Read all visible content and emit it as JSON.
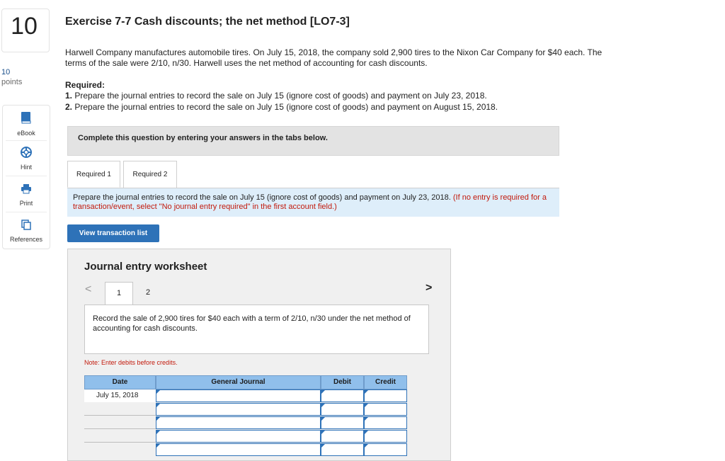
{
  "question": {
    "number": "10",
    "points_value": "10",
    "points_label": "points"
  },
  "tools": [
    {
      "label": "eBook",
      "icon": "book-icon"
    },
    {
      "label": "Hint",
      "icon": "lifebuoy-icon"
    },
    {
      "label": "Print",
      "icon": "printer-icon"
    },
    {
      "label": "References",
      "icon": "copy-icon"
    }
  ],
  "header": {
    "title": "Exercise 7-7 Cash discounts; the net method [LO7-3]",
    "intro": "Harwell Company manufactures automobile tires. On July 15, 2018, the company sold 2,900 tires to the Nixon Car Company for $40 each. The terms of the sale were 2/10, n/30. Harwell uses the net method of accounting for cash discounts.",
    "required_label": "Required:",
    "required_items": [
      {
        "num": "1.",
        "text": "Prepare the journal entries to record the sale on July 15 (ignore cost of goods) and payment on July 23, 2018."
      },
      {
        "num": "2.",
        "text": "Prepare the journal entries to record the sale on July 15 (ignore cost of goods) and payment on August 15, 2018."
      }
    ]
  },
  "complete_bar": "Complete this question by entering your answers in the tabs below.",
  "tabs": [
    {
      "label": "Required 1"
    },
    {
      "label": "Required 2"
    }
  ],
  "instruction": {
    "text": "Prepare the journal entries to record the sale on July 15 (ignore cost of goods) and payment on July 23, 2018.",
    "red_text": "(If no entry is required for a transaction/event, select \"No journal entry required\" in the first account field.)"
  },
  "view_button": "View transaction list",
  "worksheet": {
    "title": "Journal entry worksheet",
    "pages": [
      "1",
      "2"
    ],
    "prev_symbol": "<",
    "next_symbol": ">",
    "description": "Record the sale of 2,900 tires for $40 each with a term of 2/10, n/30 under the net method of accounting for cash discounts.",
    "note": "Note: Enter debits before credits.",
    "columns": [
      "Date",
      "General Journal",
      "Debit",
      "Credit"
    ],
    "rows": [
      {
        "date": "July 15, 2018",
        "account": "",
        "debit": "",
        "credit": ""
      },
      {
        "date": "",
        "account": "",
        "debit": "",
        "credit": ""
      },
      {
        "date": "",
        "account": "",
        "debit": "",
        "credit": ""
      },
      {
        "date": "",
        "account": "",
        "debit": "",
        "credit": ""
      },
      {
        "date": "",
        "account": "",
        "debit": "",
        "credit": ""
      }
    ]
  },
  "colors": {
    "link_blue": "#2e72b8",
    "instruction_red": "#c2190b",
    "grid_header": "#90bfeb",
    "instruction_bg": "#deeefa"
  }
}
